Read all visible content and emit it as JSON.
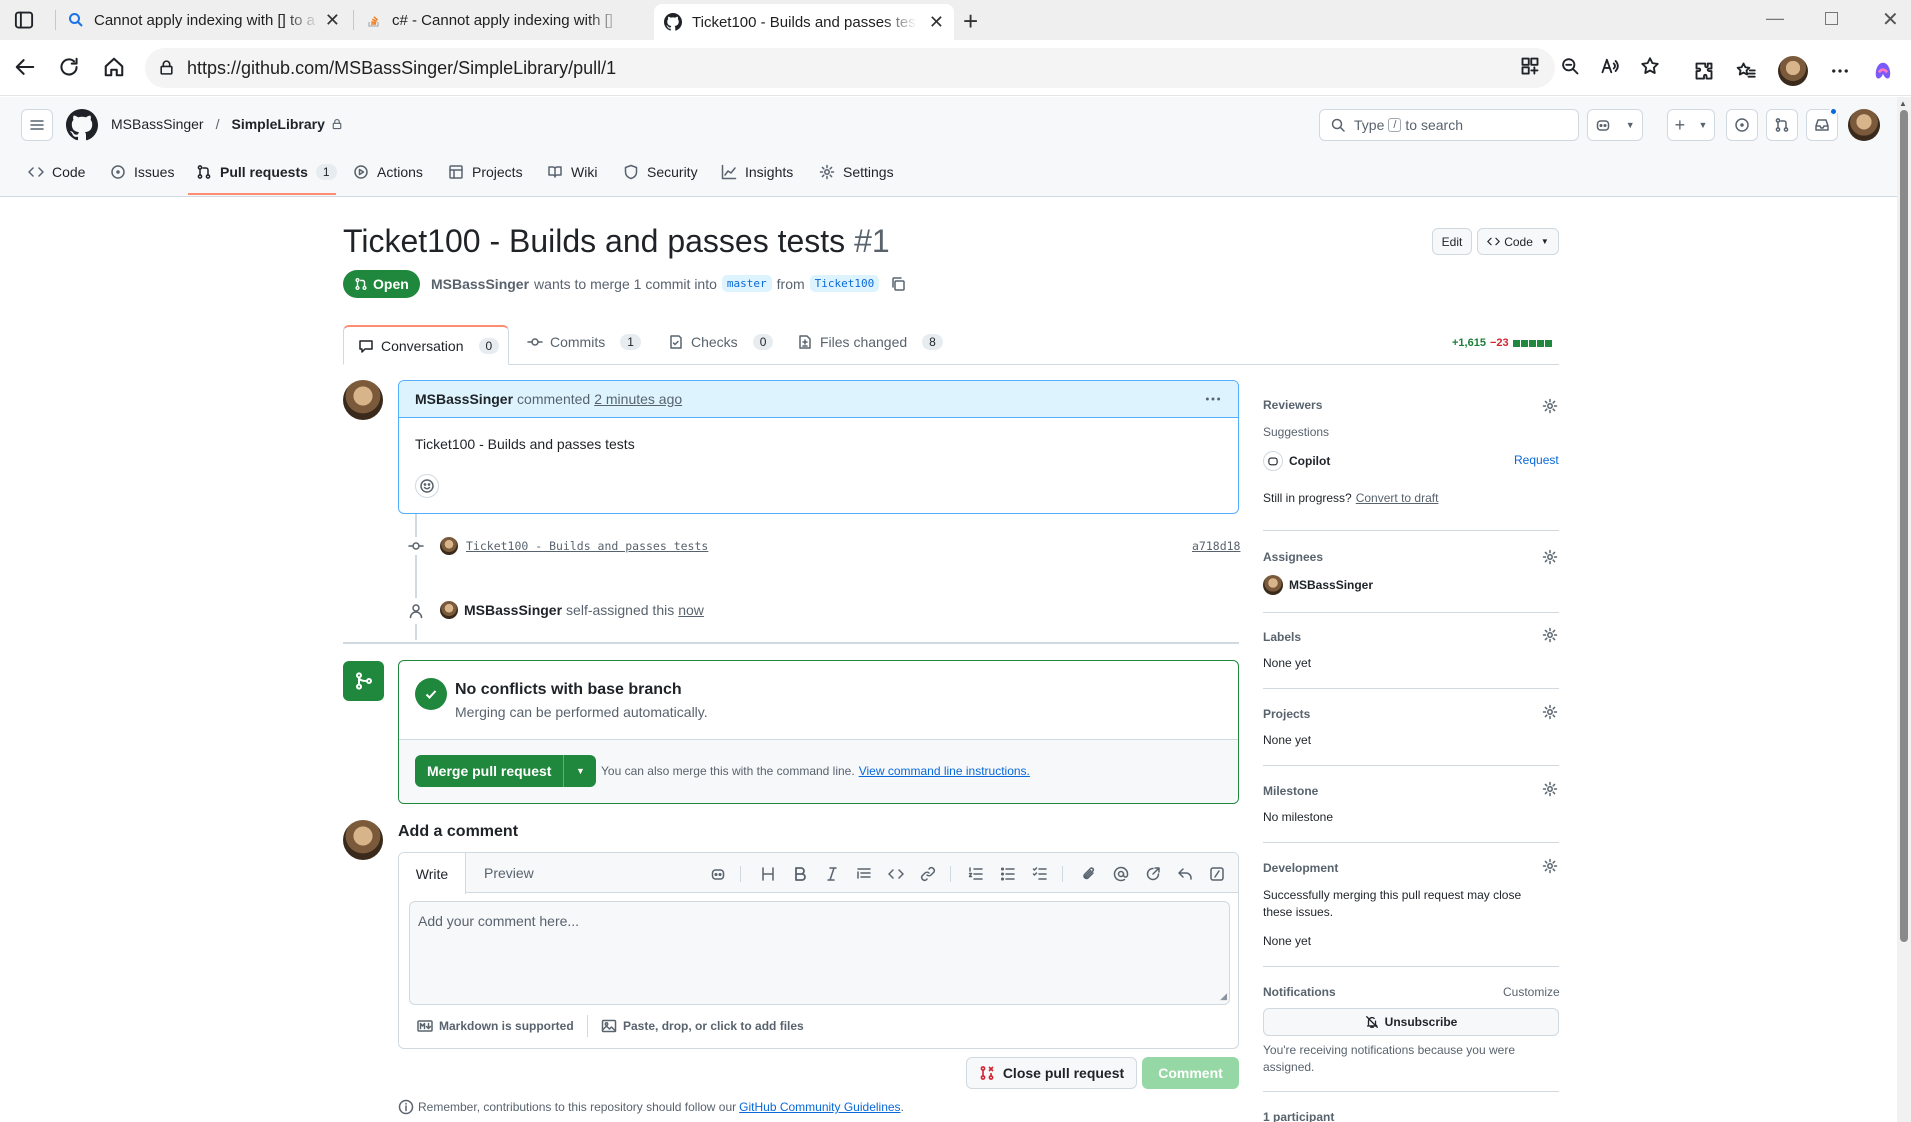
{
  "browser": {
    "tabs": [
      {
        "title": "Cannot apply indexing with [] to a",
        "icon": "search-icon"
      },
      {
        "title": "c# - Cannot apply indexing with []",
        "icon": "stackoverflow-icon"
      },
      {
        "title": "Ticket100 - Builds and passes test",
        "icon": "github-icon"
      }
    ],
    "url": "https://github.com/MSBassSinger/SimpleLibrary/pull/1"
  },
  "header": {
    "owner": "MSBassSinger",
    "separator": "/",
    "repo": "SimpleLibrary",
    "search_prefix": "Type",
    "search_key": "/",
    "search_suffix": "to search"
  },
  "repo_tabs": [
    {
      "label": "Code",
      "icon": "code-icon"
    },
    {
      "label": "Issues",
      "icon": "issue-icon"
    },
    {
      "label": "Pull requests",
      "icon": "pull-request-icon",
      "count": "1"
    },
    {
      "label": "Actions",
      "icon": "play-icon"
    },
    {
      "label": "Projects",
      "icon": "table-icon"
    },
    {
      "label": "Wiki",
      "icon": "book-icon"
    },
    {
      "label": "Security",
      "icon": "shield-icon"
    },
    {
      "label": "Insights",
      "icon": "graph-icon"
    },
    {
      "label": "Settings",
      "icon": "gear-icon"
    }
  ],
  "pr": {
    "title": "Ticket100 - Builds and passes tests",
    "number": "#1",
    "edit_label": "Edit",
    "code_label": "Code",
    "state": "Open",
    "author": "MSBassSinger",
    "merge_text": "wants to merge 1 commit into",
    "base_branch": "master",
    "from_text": "from",
    "head_branch": "Ticket100",
    "tabs": [
      {
        "label": "Conversation",
        "count": "0",
        "icon": "comment-icon"
      },
      {
        "label": "Commits",
        "count": "1",
        "icon": "commit-icon"
      },
      {
        "label": "Checks",
        "count": "0",
        "icon": "checklist-icon"
      },
      {
        "label": "Files changed",
        "count": "8",
        "icon": "file-diff-icon"
      }
    ],
    "additions": "+1,615",
    "deletions": "−23"
  },
  "comment": {
    "author": "MSBassSinger",
    "verb": "commented",
    "time": "2 minutes ago",
    "body": "Ticket100 - Builds and passes tests"
  },
  "timeline": {
    "commit_message": "Ticket100 - Builds and passes tests",
    "commit_sha": "a718d18",
    "assign_user": "MSBassSinger",
    "assign_text": "self-assigned this",
    "assign_time": "now"
  },
  "merge": {
    "title": "No conflicts with base branch",
    "subtitle": "Merging can be performed automatically.",
    "button": "Merge pull request",
    "hint": "You can also merge this with the command line.",
    "hint_link": "View command line instructions."
  },
  "composer": {
    "heading": "Add a comment",
    "tab_write": "Write",
    "tab_preview": "Preview",
    "placeholder": "Add your comment here...",
    "markdown": "Markdown is supported",
    "attach": "Paste, drop, or click to add files",
    "close_button": "Close pull request",
    "comment_button": "Comment",
    "reminder": "Remember, contributions to this repository should follow our",
    "guidelines_link": "GitHub Community Guidelines",
    "reminder_end": "."
  },
  "sidebar": {
    "reviewers": "Reviewers",
    "suggestions": "Suggestions",
    "copilot": "Copilot",
    "request": "Request",
    "still_progress": "Still in progress?",
    "convert_draft": "Convert to draft",
    "assignees": "Assignees",
    "assignee_name": "MSBassSinger",
    "labels": "Labels",
    "labels_value": "None yet",
    "projects": "Projects",
    "projects_value": "None yet",
    "milestone": "Milestone",
    "milestone_value": "No milestone",
    "development": "Development",
    "development_text": "Successfully merging this pull request may close these issues.",
    "development_value": "None yet",
    "notifications": "Notifications",
    "customize": "Customize",
    "unsubscribe": "Unsubscribe",
    "notif_reason": "You're receiving notifications because you were assigned.",
    "participants": "1 participant"
  },
  "colors": {
    "accent": "#0969da",
    "success": "#1f883d",
    "danger": "#d1242f",
    "muted": "#59636e"
  }
}
